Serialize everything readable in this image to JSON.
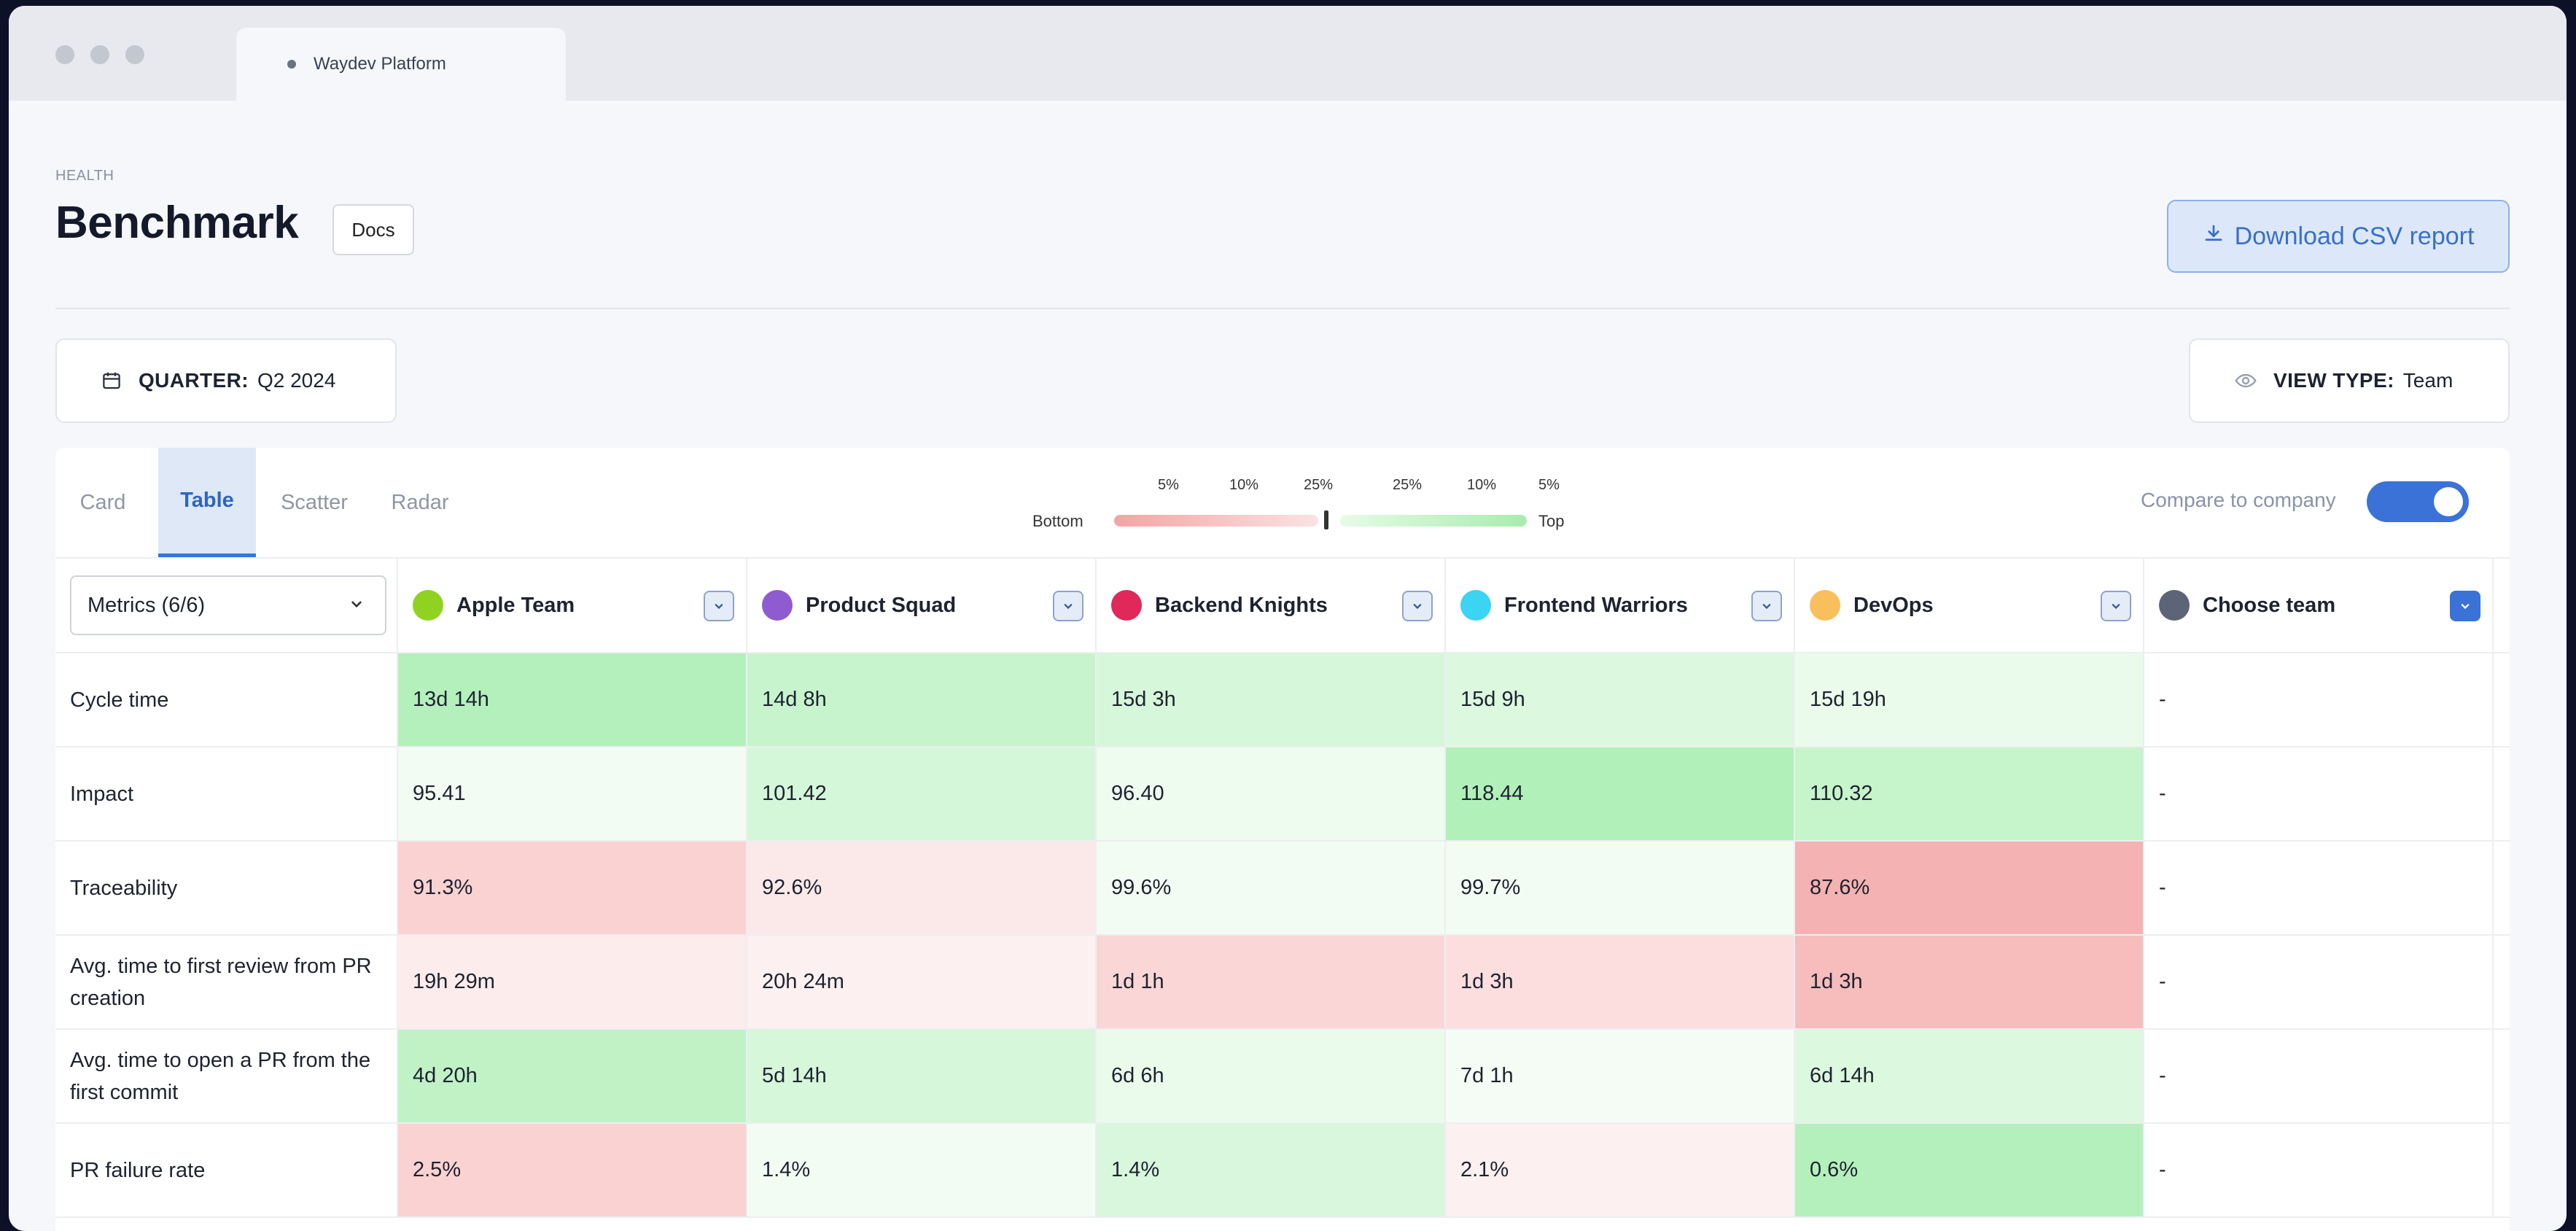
{
  "browser": {
    "tab_title": "Waydev Platform"
  },
  "header": {
    "breadcrumb": "HEALTH",
    "title": "Benchmark",
    "docs_label": "Docs",
    "download_label": "Download CSV report"
  },
  "filters": {
    "quarter_label": "QUARTER:",
    "quarter_value": "Q2 2024",
    "viewtype_label": "VIEW TYPE:",
    "viewtype_value": "Team"
  },
  "tabs": [
    "Card",
    "Table",
    "Scatter",
    "Radar"
  ],
  "active_tab": "Table",
  "legend": {
    "bottom_label": "Bottom",
    "top_label": "Top",
    "percentiles": [
      "5%",
      "10%",
      "25%",
      "25%",
      "10%",
      "5%"
    ]
  },
  "compare": {
    "label": "Compare to company",
    "enabled": true
  },
  "table": {
    "metrics_select": "Metrics (6/6)",
    "teams": [
      {
        "name": "Apple Team",
        "color": "#8fd320"
      },
      {
        "name": "Product Squad",
        "color": "#8e5bd0"
      },
      {
        "name": "Backend Knights",
        "color": "#e0285a"
      },
      {
        "name": "Frontend Warriors",
        "color": "#3bd4f2"
      },
      {
        "name": "DevOps",
        "color": "#f8c05c"
      },
      {
        "name": "Choose team",
        "color": "#5d6478"
      }
    ],
    "rows": [
      {
        "metric": "Cycle time",
        "values": [
          "13d 14h",
          "14d 8h",
          "15d 3h",
          "15d 9h",
          "15d 19h",
          "-"
        ]
      },
      {
        "metric": "Impact",
        "values": [
          "95.41",
          "101.42",
          "96.40",
          "118.44",
          "110.32",
          "-"
        ]
      },
      {
        "metric": "Traceability",
        "values": [
          "91.3%",
          "92.6%",
          "99.6%",
          "99.7%",
          "87.6%",
          "-"
        ]
      },
      {
        "metric": "Avg. time to first review from PR creation",
        "values": [
          "19h 29m",
          "20h 24m",
          "1d 1h",
          "1d 3h",
          "1d 3h",
          "-"
        ]
      },
      {
        "metric": "Avg. time to open a PR from the first commit",
        "values": [
          "4d 20h",
          "5d 14h",
          "6d 6h",
          "7d 1h",
          "6d 14h",
          "-"
        ]
      },
      {
        "metric": "PR failure rate",
        "values": [
          "2.5%",
          "1.4%",
          "1.4%",
          "2.1%",
          "0.6%",
          "-"
        ]
      }
    ],
    "cell_colors": [
      [
        "#b4f0bc",
        "#c7f4cc",
        "#d6f7da",
        "#dcf8df",
        "#eafbeb",
        "#ffffff"
      ],
      [
        "#f3fcf3",
        "#d5f7d9",
        "#eefbef",
        "#b2f0ba",
        "#c6f4cb",
        "#ffffff"
      ],
      [
        "#fad2d2",
        "#fbe9e9",
        "#f3fcf3",
        "#f3fcf3",
        "#f5b2b2",
        "#ffffff"
      ],
      [
        "#fdecec",
        "#fdf0f0",
        "#fbd6d6",
        "#fcdede",
        "#f7bcbc",
        "#ffffff"
      ],
      [
        "#c0f2c6",
        "#d6f7da",
        "#eafbeb",
        "#f5fcf5",
        "#dcf8df",
        "#ffffff"
      ],
      [
        "#fbd2d2",
        "#f3fcf3",
        "#d8f7dc",
        "#fcf0f0",
        "#b4f0bc",
        "#ffffff"
      ]
    ]
  }
}
